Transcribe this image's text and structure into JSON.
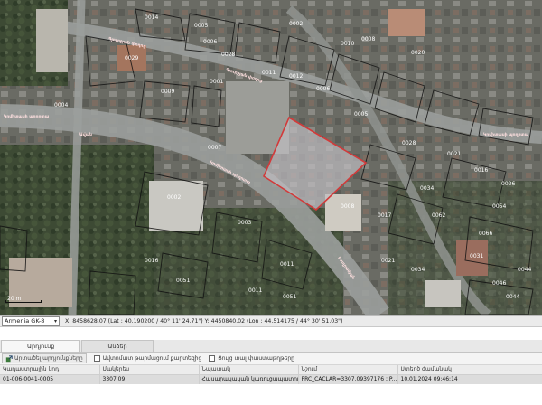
{
  "map": {
    "road_labels": [
      "Կոմիտասի պողոտա",
      "Գյուրջյան փողոց",
      "Գյուրջյան փողոց",
      "Ավան",
      "Կոմիտասի պողոտա",
      "Բաղրամյան",
      "Կոմիտասի պողոտա"
    ],
    "parcel_labels": [
      "0014",
      "0005",
      "0002",
      "0006",
      "0028",
      "0029",
      "0011",
      "0010",
      "0012",
      "0008",
      "0020",
      "0021",
      "0001",
      "0002",
      "0004",
      "0009",
      "0006",
      "0007",
      "0003",
      "0011",
      "0005",
      "0028",
      "0016",
      "0026",
      "0017",
      "0008",
      "0062",
      "0031",
      "0034",
      "0051",
      "0021",
      "0046",
      "0044",
      "0044",
      "0016",
      "0011",
      "0034",
      "0051",
      "0054",
      "0066"
    ],
    "scale_label": "20 m",
    "parcel_highlight_color": "#d23a3a",
    "road_color": "#9b9f9c"
  },
  "coordbar": {
    "crs_value": "Armenia GK-8",
    "coord_text": "X: 8458628.07 (Lat : 40.190200 / 40° 11' 24.71\")   Y: 4450840.02 (Lon : 44.514175 / 44° 30' 51.03\")"
  },
  "panel": {
    "tabs": [
      "Արդյունք",
      "Անձեր"
    ],
    "toolbar": {
      "button_label": "Արտածել արդյունքները",
      "checkbox1_label": "Ավտոմատ թարմացում քարտեզից",
      "checkbox2_label": "Ցույց տալ փաստաթղթերը"
    },
    "table": {
      "headers": [
        "Կադաստրային կոդ",
        "Մակերես",
        "Նպատակ",
        "Նշում",
        "Ստեղծ ժամանակ"
      ],
      "rows": [
        [
          "01-006-0041-0005",
          "3307.09",
          "Հասարակական կառուցապատում",
          "PRC_CACLAR=3307.09397176 ; P...",
          "10.01.2024 09:46:14"
        ]
      ]
    }
  }
}
